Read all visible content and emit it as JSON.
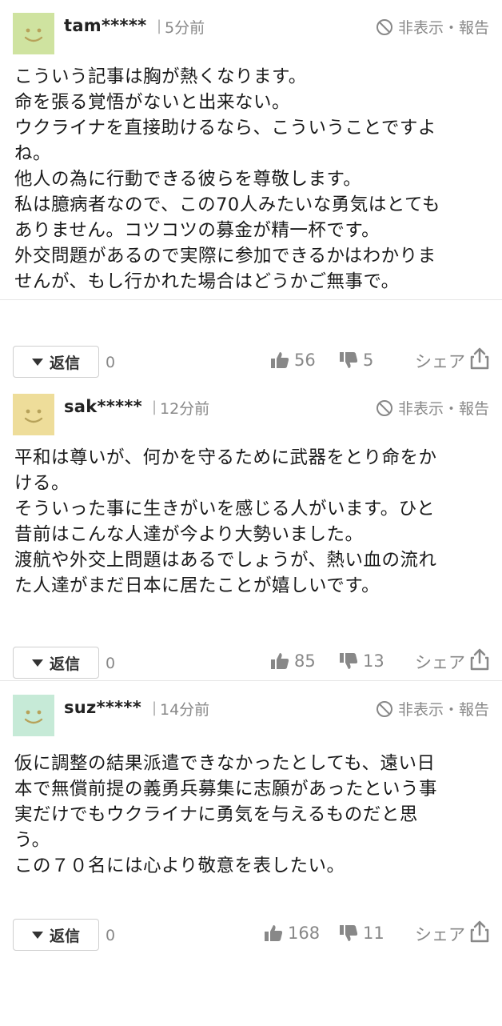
{
  "comments": [
    {
      "user": "tam*****",
      "separator": "|",
      "time": "5分前",
      "hide_report": "非表示・報告",
      "avatar_color": "#cfe3a0",
      "lines": [
        "こういう記事は胸が熱くなります。",
        "命を張る覚悟がないと出来ない。",
        "ウクライナを直接助けるなら、こういうことですよ",
        "ね。",
        "他人の為に行動できる彼らを尊敬します。",
        "私は臆病者なので、この70人みたいな勇気はとても",
        "ありません。コツコツの募金が精一杯です。",
        "外交問題があるので実際に参加できるかはわかりま",
        "せんが、もし行かれた場合はどうかご無事で。"
      ],
      "reply_label": "返信",
      "reply_count": "0",
      "likes": "56",
      "dislikes": "5",
      "share_label": "シェア"
    },
    {
      "user": "sak*****",
      "separator": "|",
      "time": "12分前",
      "hide_report": "非表示・報告",
      "avatar_color": "#eedd9a",
      "lines": [
        "平和は尊いが、何かを守るために武器をとり命をか",
        "ける。",
        "そういった事に生きがいを感じる人がいます。ひと",
        "昔前はこんな人達が今より大勢いました。",
        "渡航や外交上問題はあるでしょうが、熱い血の流れ",
        "た人達がまだ日本に居たことが嬉しいです。"
      ],
      "reply_label": "返信",
      "reply_count": "0",
      "likes": "85",
      "dislikes": "13",
      "share_label": "シェア"
    },
    {
      "user": "suz*****",
      "separator": "|",
      "time": "14分前",
      "hide_report": "非表示・報告",
      "avatar_color": "#c6ead7",
      "lines": [
        "仮に調整の結果派遣できなかったとしても、遠い日",
        "本で無償前提の義勇兵募集に志願があったという事",
        "実だけでもウクライナに勇気を与えるものだと思",
        "う。",
        "この７０名には心より敬意を表したい。"
      ],
      "reply_label": "返信",
      "reply_count": "0",
      "likes": "168",
      "dislikes": "11",
      "share_label": "シェア"
    }
  ],
  "colors": {
    "text": "#1a1a1a",
    "meta": "#888888",
    "border": "#cfcfcf",
    "face": "#b7a25a"
  }
}
